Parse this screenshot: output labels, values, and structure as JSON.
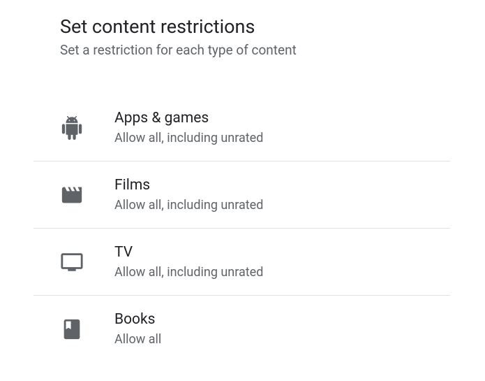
{
  "header": {
    "title": "Set content restrictions",
    "subtitle": "Set a restriction for each type of content"
  },
  "items": [
    {
      "icon": "android-icon",
      "title": "Apps & games",
      "subtitle": "Allow all, including unrated"
    },
    {
      "icon": "film-icon",
      "title": "Films",
      "subtitle": "Allow all, including unrated"
    },
    {
      "icon": "tv-icon",
      "title": "TV",
      "subtitle": "Allow all, including unrated"
    },
    {
      "icon": "book-icon",
      "title": "Books",
      "subtitle": "Allow all"
    }
  ]
}
